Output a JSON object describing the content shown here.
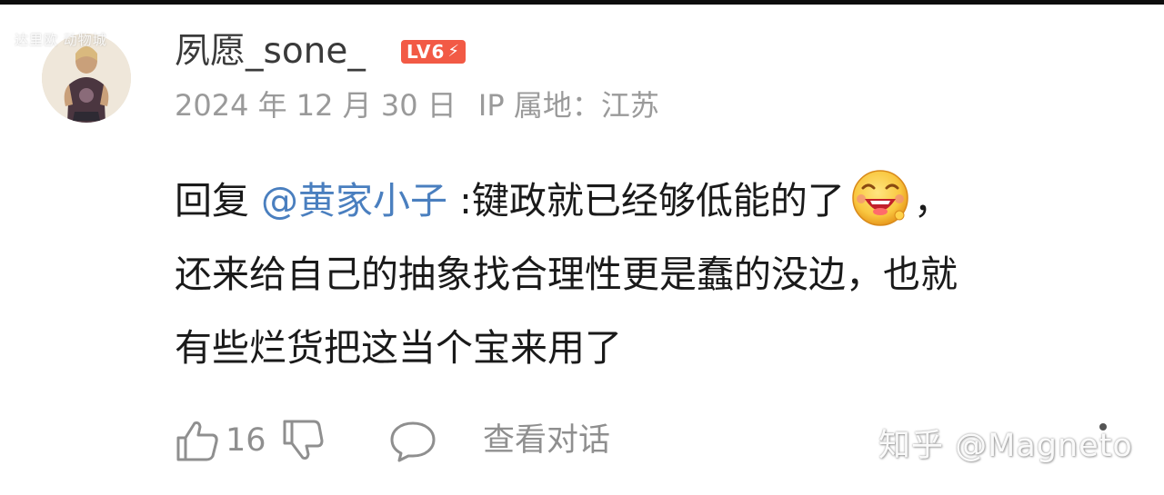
{
  "watermark_top_left": "达里欧 动物城",
  "user": {
    "name": "夙愿_sone_",
    "level_badge": "LV6",
    "avatar_icon": "user-avatar"
  },
  "meta": {
    "date": "2024 年 12 月 30 日",
    "ip_location": "IP 属地：江苏"
  },
  "comment": {
    "reply_prefix": "回复 ",
    "mention": "@黄家小子",
    "text_line1": " :键政就已经够低能的了",
    "emoji": "laughing-face-emoji",
    "text_line1_end": "，",
    "text_line2": "还来给自己的抽象找合理性更是蠢的没边，也就",
    "text_line3": "有些烂货把这当个宝来用了"
  },
  "actions": {
    "like_count": "16",
    "like_icon": "thumbs-up-icon",
    "dislike_icon": "thumbs-down-icon",
    "reply_icon": "comment-bubble-icon",
    "view_dialog_label": "查看对话"
  },
  "watermark": "知乎 @Magneto",
  "colors": {
    "mention": "#4a7fbf",
    "level_badge_bg": "#f25a45",
    "meta_text": "#9a9a9a",
    "action_icons": "#8f8f8f"
  }
}
